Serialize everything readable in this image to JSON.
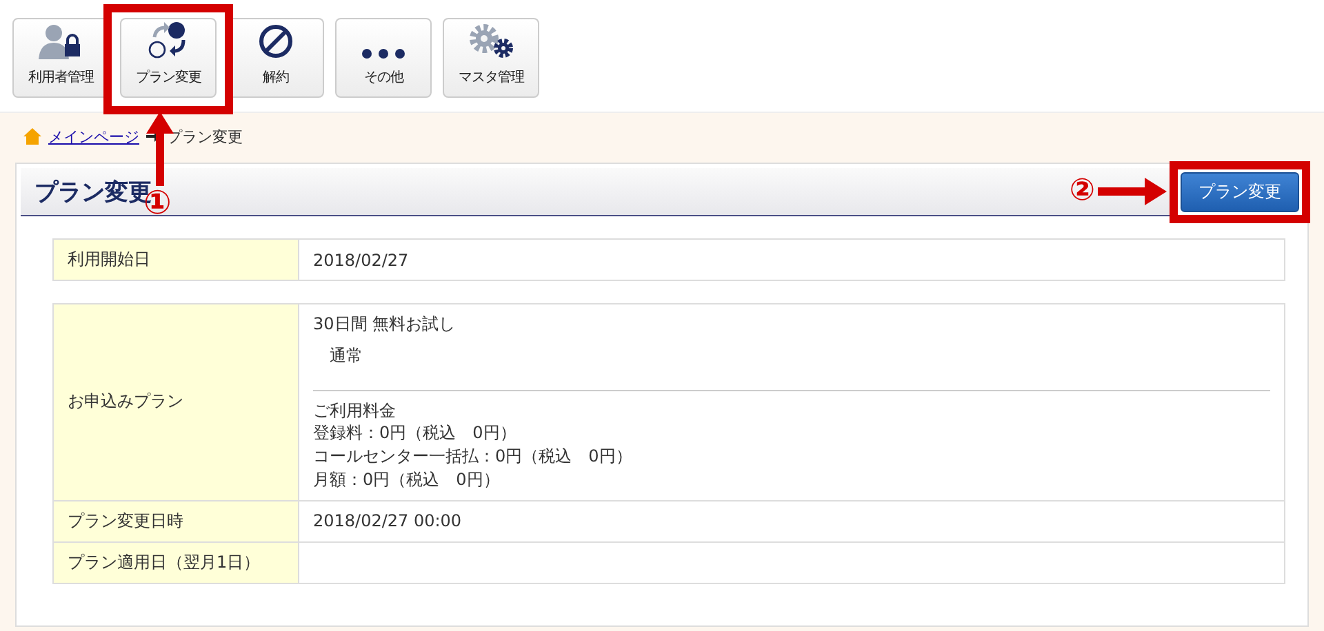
{
  "toolbar": [
    {
      "kind": "user-lock",
      "label": "利用者管理"
    },
    {
      "kind": "swap",
      "label": "プラン変更"
    },
    {
      "kind": "ban",
      "label": "解約"
    },
    {
      "kind": "dots",
      "label": "その他"
    },
    {
      "kind": "gears",
      "label": "マスタ管理"
    }
  ],
  "breadcrumb": {
    "home": "メインページ",
    "current": "プラン変更"
  },
  "panel": {
    "title": "プラン変更",
    "button": "プラン変更"
  },
  "start_table": [
    {
      "label": "利用開始日",
      "value": "2018/02/27"
    }
  ],
  "plan_table": {
    "label": "お申込みプラン",
    "plan_name": "30日間 無料お試し",
    "plan_type": "通常",
    "fee_heading": "ご利用料金",
    "fees": [
      "登録料：0円（税込　0円）",
      "コールセンター一括払：0円（税込　0円）",
      "月額：0円（税込　0円）"
    ]
  },
  "plan_rows": [
    {
      "label": "プラン変更日時",
      "value": "2018/02/27 00:00"
    },
    {
      "label": "プラン適用日（翌月1日）",
      "value": ""
    }
  ],
  "annotations": [
    {
      "kind": "toolbar",
      "label": "①"
    },
    {
      "kind": "header-button",
      "label": "②"
    }
  ]
}
